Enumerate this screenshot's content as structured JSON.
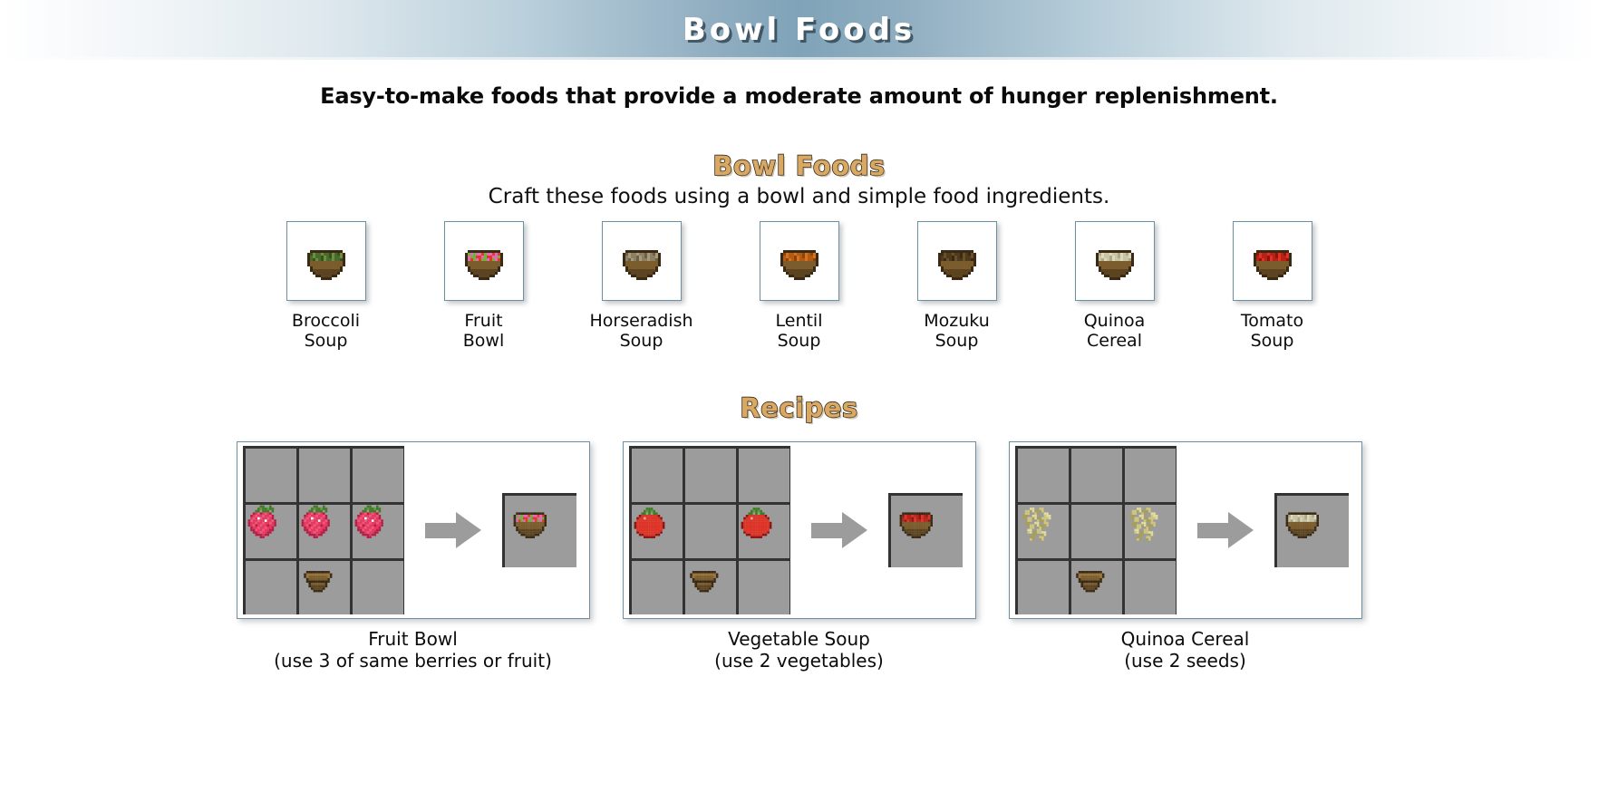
{
  "header": {
    "title": "Bowl Foods",
    "subtitle": "Easy-to-make foods that provide a moderate amount of hunger replenishment."
  },
  "colors": {
    "banner_center": "#7fa3b8",
    "heading_tan": "#d9a963",
    "heading_outline": "#1a1208",
    "card_border": "#6e8ea1",
    "grid_cell": "#9c9c9c",
    "grid_line": "#333333",
    "arrow": "#9c9c9c"
  },
  "bowl_section": {
    "heading": "Bowl Foods",
    "description": "Craft these foods using a bowl and simple food ingredients.",
    "items": [
      {
        "name": "Broccoli\nSoup",
        "icon": "broccoli-soup-icon",
        "sprite": "broccoli_soup"
      },
      {
        "name": "Fruit\nBowl",
        "icon": "fruit-bowl-icon",
        "sprite": "fruit_bowl"
      },
      {
        "name": "Horseradish\nSoup",
        "icon": "horseradish-soup-icon",
        "sprite": "horseradish_soup"
      },
      {
        "name": "Lentil\nSoup",
        "icon": "lentil-soup-icon",
        "sprite": "lentil_soup"
      },
      {
        "name": "Mozuku\nSoup",
        "icon": "mozuku-soup-icon",
        "sprite": "mozuku_soup"
      },
      {
        "name": "Quinoa\nCereal",
        "icon": "quinoa-cereal-icon",
        "sprite": "quinoa_cereal"
      },
      {
        "name": "Tomato\nSoup",
        "icon": "tomato-soup-icon",
        "sprite": "tomato_soup"
      }
    ]
  },
  "recipes_section": {
    "heading": "Recipes",
    "recipes": [
      {
        "caption": "Fruit Bowl\n(use 3 of same berries or fruit)",
        "ingredients": [
          "",
          "",
          "",
          "strawberry",
          "strawberry",
          "strawberry",
          "",
          "bowl",
          ""
        ],
        "output": "fruit_bowl",
        "output_icon": "fruit-bowl-icon"
      },
      {
        "caption": "Vegetable Soup\n(use 2 vegetables)",
        "ingredients": [
          "",
          "",
          "",
          "tomato",
          "",
          "tomato",
          "",
          "bowl",
          ""
        ],
        "output": "tomato_soup",
        "output_icon": "tomato-soup-icon"
      },
      {
        "caption": "Quinoa Cereal\n(use 2 seeds)",
        "ingredients": [
          "",
          "",
          "",
          "seeds",
          "",
          "seeds",
          "",
          "bowl",
          ""
        ],
        "output": "quinoa_cereal",
        "output_icon": "quinoa-cereal-icon"
      }
    ]
  }
}
